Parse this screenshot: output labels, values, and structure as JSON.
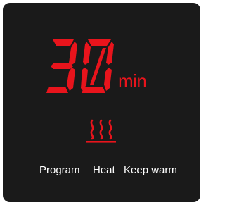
{
  "display": {
    "timer_digits": "30",
    "timer_unit": "min"
  },
  "indicator": {
    "icon": "heat-waves-icon",
    "active_mode": "Heat"
  },
  "modes": [
    {
      "label": "Program"
    },
    {
      "label": "Heat"
    },
    {
      "label": "Keep warm"
    }
  ],
  "colors": {
    "panel_background": "#1a1a1a",
    "segment_on": "#e8141c",
    "label_text": "#ffffff"
  }
}
